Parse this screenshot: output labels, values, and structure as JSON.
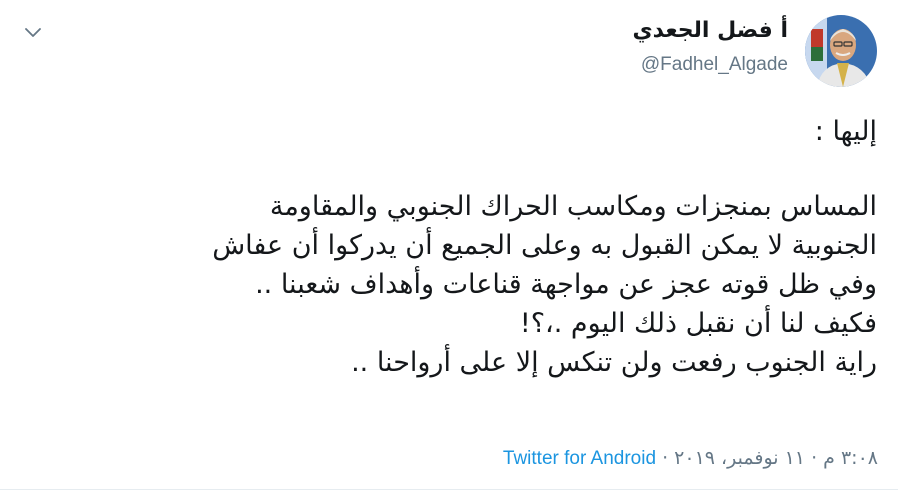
{
  "author": {
    "name": "أ فضل الجعدي",
    "handle": "@Fadhel_Algade"
  },
  "tweet": {
    "line1": "إليها :",
    "line2": "المساس بمنجزات ومكاسب الحراك الجنوبي والمقاومة",
    "line3": "الجنوبية لا يمكن القبول به وعلى الجميع أن يدركوا أن عفاش",
    "line4": "وفي ظل قوته عجز عن مواجهة قناعات وأهداف شعبنا ..",
    "line5": "فكيف لنا أن نقبل ذلك اليوم .،؟!",
    "line6": "راية الجنوب رفعت ولن تنكس إلا على أرواحنا .."
  },
  "meta": {
    "time": "٣:٠٨ م",
    "date": "١١ نوفمبر، ٢٠١٩",
    "separator": "·",
    "source": "Twitter for Android"
  }
}
